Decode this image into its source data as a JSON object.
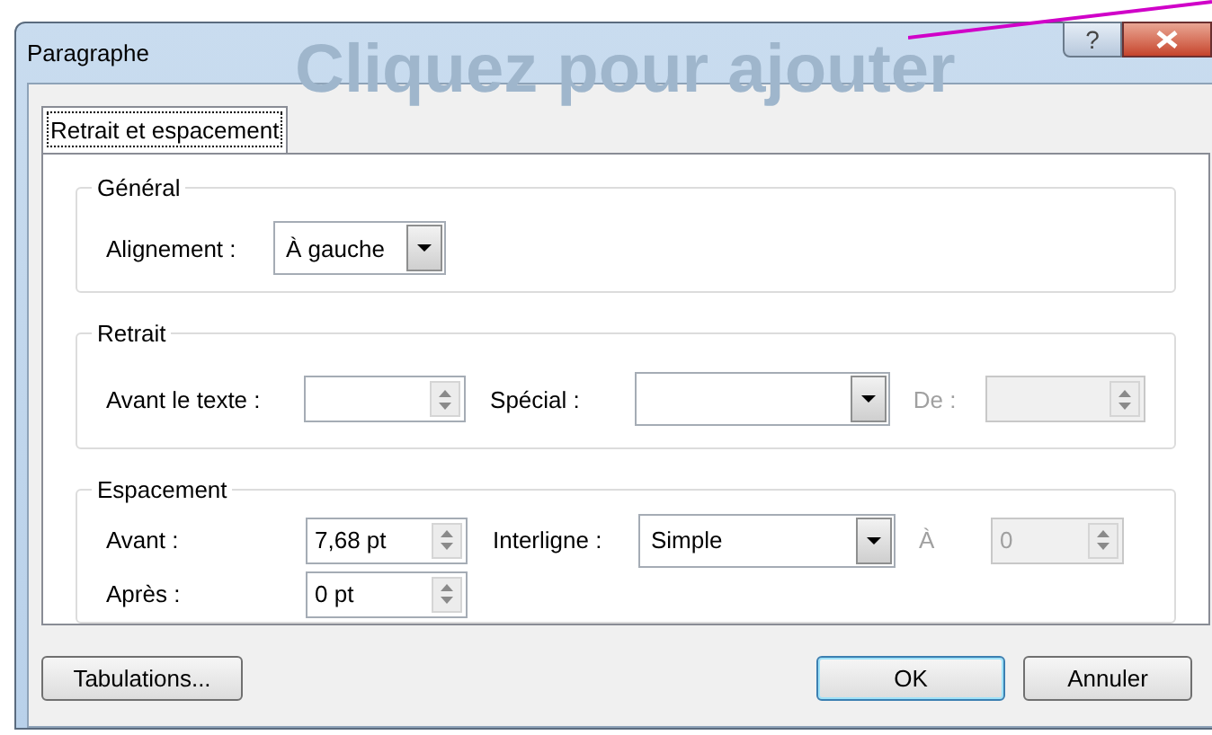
{
  "window": {
    "title": "Paragraphe",
    "background_text": "Cliquez pour ajouter",
    "help_button": "?"
  },
  "tabs": [
    {
      "label": "Retrait et espacement",
      "selected": true
    }
  ],
  "general": {
    "title": "Général",
    "alignment": {
      "label": "Alignement :",
      "value": "À gauche"
    }
  },
  "indent": {
    "title": "Retrait",
    "before_text": {
      "label": "Avant le texte :",
      "disabled": false
    },
    "special": {
      "label": "Spécial :"
    },
    "by": {
      "label": "De :",
      "disabled": true
    }
  },
  "spacing": {
    "title": "Espacement",
    "before": {
      "label": "Avant :",
      "value": "7,68 pt",
      "disabled": false
    },
    "line_spacing": {
      "label": "Interligne :",
      "value": "Simple"
    },
    "at": {
      "label": "À",
      "value": "0",
      "disabled": true
    },
    "after": {
      "label": "Après :",
      "value": "0 pt",
      "disabled": false
    }
  },
  "buttons": [
    {
      "kind": "tabs",
      "label": "Tabulations..."
    },
    {
      "kind": "ok",
      "label": "OK"
    },
    {
      "kind": "cancel",
      "label": "Annuler"
    }
  ]
}
